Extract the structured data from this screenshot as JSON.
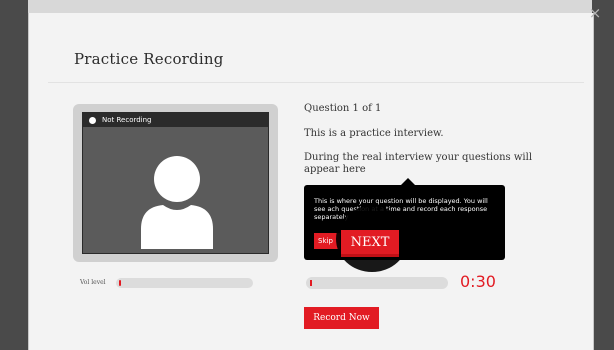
{
  "modal": {
    "title": "Practice Recording",
    "close_glyph": "×"
  },
  "camera": {
    "status_label": "Not Recording",
    "avatar_icon": "person-silhouette-icon"
  },
  "volume": {
    "label": "Vol level",
    "level": 0.02
  },
  "question": {
    "count": "Question 1 of 1",
    "intro": "This is a practice interview.",
    "description": "During the real interview your questions will appear here"
  },
  "tooltip": {
    "text": "This is where your question will be displayed. You will see ach question at a time and record each response separately",
    "skip_label": "Skip",
    "next_label": "NEXT"
  },
  "recording": {
    "progress": 0.01,
    "timer": "0:30",
    "record_label": "Record Now"
  },
  "colors": {
    "accent": "#e21b23",
    "tooltip_bg": "#000000",
    "modal_bg": "#f3f3f3"
  }
}
